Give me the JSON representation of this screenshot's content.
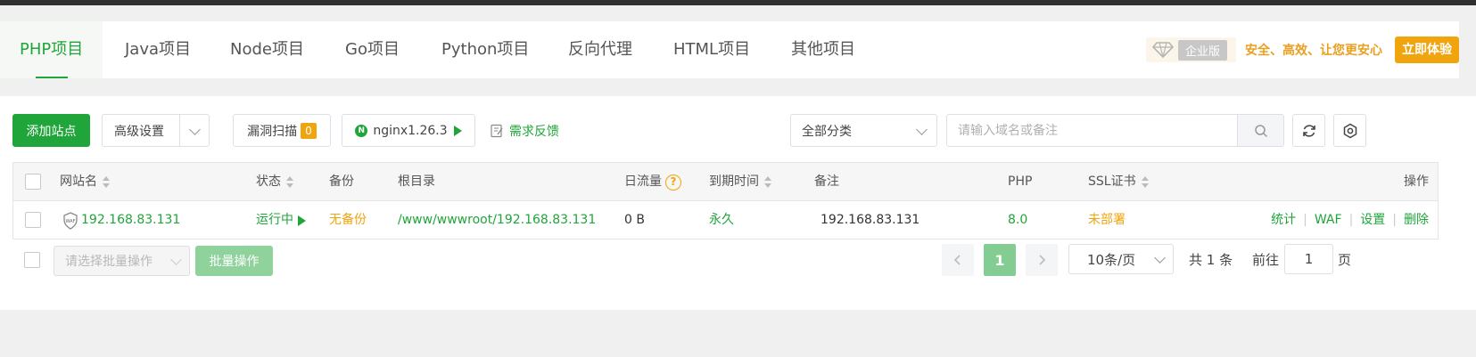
{
  "nav": {
    "tabs": [
      "PHP项目",
      "Java项目",
      "Node项目",
      "Go项目",
      "Python项目",
      "反向代理",
      "HTML项目",
      "其他项目"
    ],
    "active_index": 0
  },
  "promo": {
    "badge": "企业版",
    "text": "安全、高效、让您更安心",
    "button": "立即体验"
  },
  "toolbar": {
    "add_site": "添加站点",
    "advanced": "高级设置",
    "vuln_scan": "漏洞扫描",
    "vuln_count": "0",
    "nginx_label": "nginx1.26.3",
    "nginx_icon": "N",
    "feedback": "需求反馈",
    "category": "全部分类",
    "search_placeholder": "请输入域名或备注"
  },
  "table": {
    "headers": {
      "site": "网站名",
      "status": "状态",
      "backup": "备份",
      "root": "根目录",
      "traffic": "日流量",
      "expire": "到期时间",
      "remark": "备注",
      "php": "PHP",
      "ssl": "SSL证书",
      "ops": "操作"
    },
    "rows": [
      {
        "site": "192.168.83.131",
        "waf_tag": "WAF",
        "status": "运行中",
        "backup": "无备份",
        "root": "/www/wwwroot/192.168.83.131",
        "traffic": "0 B",
        "expire": "永久",
        "remark": "192.168.83.131",
        "php": "8.0",
        "ssl": "未部署",
        "ops": [
          "统计",
          "WAF",
          "设置",
          "删除"
        ]
      }
    ]
  },
  "footer": {
    "batch_placeholder": "请选择批量操作",
    "batch_button": "批量操作",
    "current_page": "1",
    "page_size": "10条/页",
    "total": "共 1 条",
    "goto_prefix": "前往",
    "goto_value": "1",
    "goto_suffix": "页"
  },
  "colors": {
    "accent": "#20a53a",
    "warning": "#f0a40d"
  }
}
